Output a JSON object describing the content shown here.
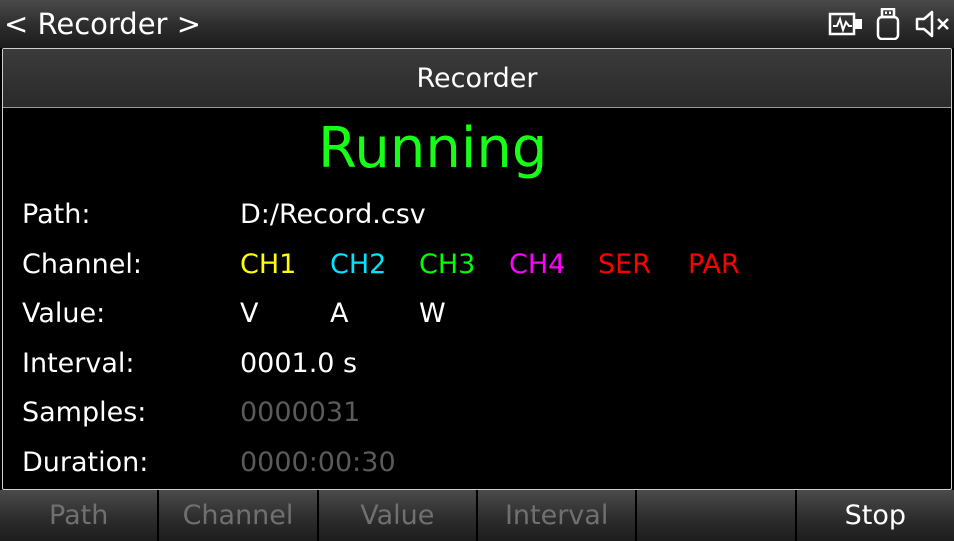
{
  "topbar": {
    "title": "< Recorder >",
    "icons": [
      "meter-icon",
      "usb-icon",
      "speaker-mute-icon"
    ]
  },
  "panel": {
    "title": "Recorder",
    "status": "Running",
    "status_color": "#17ff17",
    "rows": {
      "path": {
        "label": "Path:",
        "value": "D:/Record.csv"
      },
      "channel": {
        "label": "Channel:",
        "items": [
          {
            "text": "CH1",
            "color": "#ffff00"
          },
          {
            "text": "CH2",
            "color": "#00e5ff"
          },
          {
            "text": "CH3",
            "color": "#00ff00"
          },
          {
            "text": "CH4",
            "color": "#ff00ff"
          },
          {
            "text": "SER",
            "color": "#ff0000"
          },
          {
            "text": "PAR",
            "color": "#ff0000"
          }
        ]
      },
      "value": {
        "label": "Value:",
        "items": [
          "V",
          "A",
          "W"
        ]
      },
      "interval": {
        "label": "Interval:",
        "value": "0001.0 s"
      },
      "samples": {
        "label": "Samples:",
        "value": "0000031"
      },
      "duration": {
        "label": "Duration:",
        "value": "0000:00:30"
      }
    }
  },
  "softkeys": [
    "Path",
    "Channel",
    "Value",
    "Interval",
    "",
    "Stop"
  ]
}
